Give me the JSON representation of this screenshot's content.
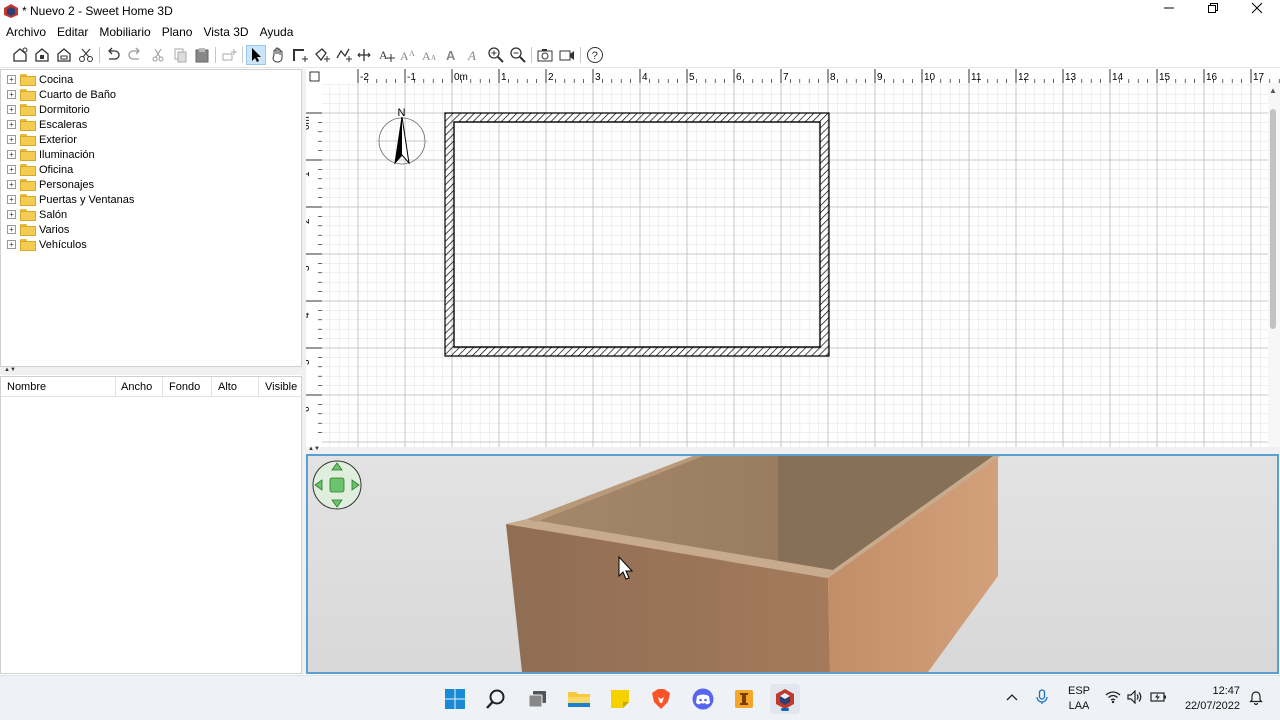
{
  "window": {
    "title": "* Nuevo 2 - Sweet Home 3D",
    "minimize_icon": "minimize-icon",
    "restore_icon": "restore-icon",
    "close_icon": "close-icon"
  },
  "menu": [
    "Archivo",
    "Editar",
    "Mobiliario",
    "Plano",
    "Vista 3D",
    "Ayuda"
  ],
  "toolbar": {
    "icons": [
      "new-home-icon",
      "open-icon",
      "save-icon",
      "cut-icon-2",
      "undo-icon",
      "redo-icon",
      "cut-icon",
      "copy-icon",
      "paste-icon",
      "add-furniture-icon",
      "select-icon",
      "pan-icon",
      "create-walls-icon",
      "create-rooms-icon",
      "create-polylines-icon",
      "create-dimensions-icon",
      "add-text-icon",
      "increase-text-icon",
      "decrease-text-icon",
      "bold-icon",
      "italic-icon",
      "zoom-in-icon",
      "zoom-out-icon",
      "create-photo-icon",
      "create-video-icon",
      "help-icon"
    ]
  },
  "catalog": {
    "categories": [
      "Cocina",
      "Cuarto de Baño",
      "Dormitorio",
      "Escaleras",
      "Exterior",
      "Iluminación",
      "Oficina",
      "Personajes",
      "Puertas y Ventanas",
      "Salón",
      "Varios",
      "Vehículos"
    ]
  },
  "furniture_table": {
    "columns": [
      "Nombre",
      "Ancho",
      "Fondo",
      "Alto",
      "Visible"
    ]
  },
  "plan": {
    "ruler_x_labels": [
      "-2",
      "-1",
      "0m",
      "1",
      "2",
      "3",
      "4",
      "5",
      "6",
      "7",
      "8",
      "9",
      "10",
      "11",
      "12",
      "13",
      "14",
      "15",
      "16",
      "17"
    ],
    "ruler_y_labels": [
      "0m",
      "1",
      "2",
      "3",
      "4",
      "5",
      "6"
    ],
    "compass_label": "N"
  },
  "taskbar": {
    "apps": [
      "windows-start-icon",
      "search-icon",
      "task-view-icon",
      "file-explorer-icon",
      "sticky-notes-icon",
      "brave-browser-icon",
      "discord-icon",
      "app-icon",
      "sweet-home-3d-icon"
    ],
    "language": "ESP",
    "layout": "LAA",
    "time": "12:47",
    "date": "22/07/2022"
  },
  "colors": {
    "accent": "#0067c0",
    "wall_outer": "#a07657",
    "wall_top": "#c9a98a",
    "selection_border": "#5a9fd4"
  }
}
